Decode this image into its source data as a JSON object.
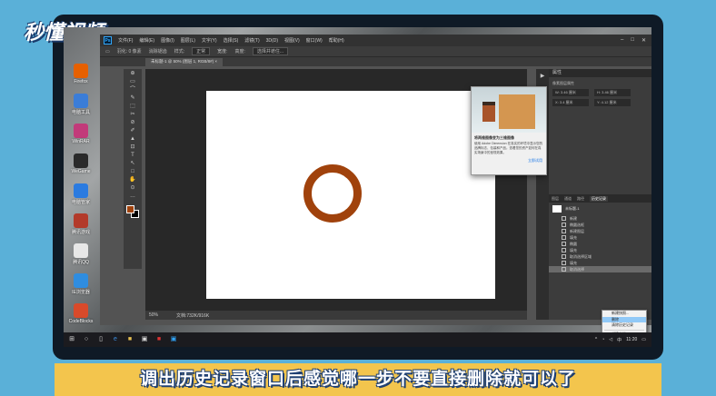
{
  "watermark": "秒懂视频",
  "desktop_icons": [
    {
      "label": "Firefox",
      "color": "#e66000"
    },
    {
      "label": "电脑工具",
      "color": "#3b7dd8"
    },
    {
      "label": "WinRAR",
      "color": "#c23a7a"
    },
    {
      "label": "WeGame",
      "color": "#2a2a2a"
    },
    {
      "label": "电脑管家",
      "color": "#2b7be0"
    },
    {
      "label": "腾讯游戏",
      "color": "#b33a2a"
    },
    {
      "label": "腾讯QQ",
      "color": "#e7e7e7"
    },
    {
      "label": "IE浏览器",
      "color": "#2f8de0"
    },
    {
      "label": "CodeBlocks",
      "color": "#d94a2a"
    }
  ],
  "ps": {
    "logo": "Ps",
    "menu": [
      "文件(F)",
      "编辑(E)",
      "图像(I)",
      "图层(L)",
      "文字(Y)",
      "选择(S)",
      "滤镜(T)",
      "3D(D)",
      "视图(V)",
      "窗口(W)",
      "帮助(H)"
    ],
    "options": {
      "feather": "羽化: 0 像素",
      "antialias": "消除锯齿",
      "style_label": "样式:",
      "style_value": "正常",
      "width_label": "宽度:",
      "height_label": "高度:",
      "select_mask": "选择并遮住..."
    },
    "tab": "未标题-1 @ 50% (图层 1, RGB/8#) ×",
    "tools": [
      "⊕",
      "▭",
      "⌒",
      "✎",
      "⬚",
      "✂",
      "⊘",
      "✐",
      "▲",
      "⊡",
      "T",
      "↖",
      "□",
      "✋",
      "⊙",
      "…"
    ],
    "statusbar": {
      "zoom": "50%",
      "doc": "文档:732K/916K"
    },
    "popup": {
      "title": "将两维图像变为三维图像",
      "body": "使用 Adobe Dimension 在真实的环境中显示您的品牌标志、包装和产品。查看您的资产如何在真实场景中的呈现效果。",
      "link": "立即试用"
    },
    "properties": {
      "header": "属性",
      "subtitle": "像素图层属性",
      "w": "W: 3.46 厘米",
      "h": "H: 3.46 厘米",
      "x": "X: 3.4 厘米",
      "y": "Y: 4.12 厘米"
    },
    "history": {
      "tabs": [
        "图层",
        "通道",
        "路径",
        "历史记录"
      ],
      "snapshot": "未标题-1",
      "steps": [
        "新建",
        "椭圆选框",
        "新建图层",
        "填充",
        "椭圆",
        "填充",
        "取消选择区域",
        "填充",
        "取消选择"
      ]
    },
    "context_menu": [
      "新建快照...",
      "删除",
      "清除历史记录",
      "新建文档"
    ]
  },
  "taskbar": {
    "start": "⊞",
    "time": "11:20",
    "lang": "中"
  },
  "subtitle": "调出历史记录窗口后感觉哪一步不要直接删除就可以了"
}
